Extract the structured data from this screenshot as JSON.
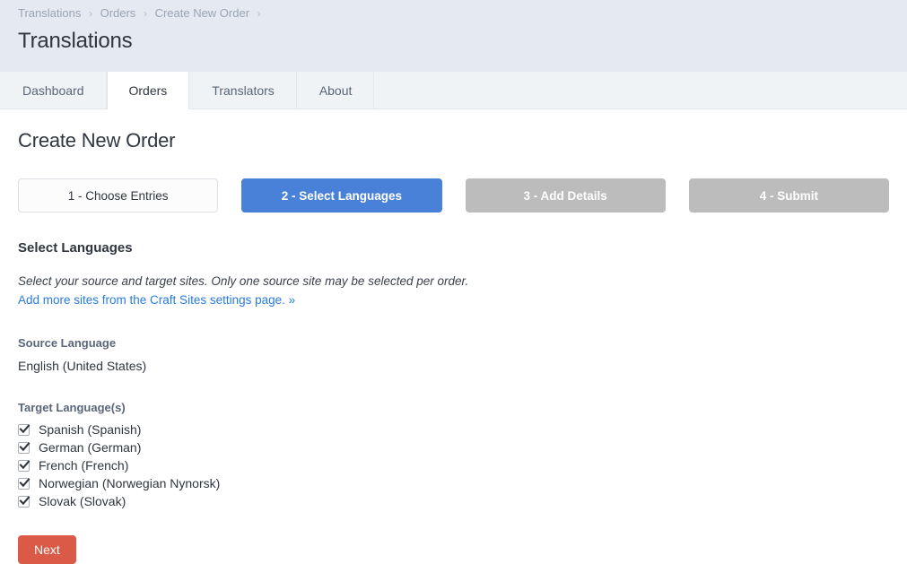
{
  "header": {
    "breadcrumbs": [
      {
        "label": "Translations"
      },
      {
        "label": "Orders"
      },
      {
        "label": "Create New Order"
      }
    ],
    "separator": "›",
    "app_title": "Translations"
  },
  "tabs": [
    {
      "label": "Dashboard",
      "active": false
    },
    {
      "label": "Orders",
      "active": true
    },
    {
      "label": "Translators",
      "active": false
    },
    {
      "label": "About",
      "active": false
    }
  ],
  "main": {
    "page_title": "Create New Order",
    "steps": [
      {
        "label": "1 - Choose Entries",
        "state": "complete"
      },
      {
        "label": "2 - Select Languages",
        "state": "current"
      },
      {
        "label": "3 - Add Details",
        "state": "disabled"
      },
      {
        "label": "4 - Submit",
        "state": "disabled"
      }
    ],
    "section_heading": "Select Languages",
    "section_description": "Select your source and target sites. Only one source site may be selected per order.",
    "section_link": "Add more sites from the Craft Sites settings page. »",
    "source_language_label": "Source Language",
    "source_language_value": "English (United States)",
    "target_language_label": "Target Language(s)",
    "target_languages": [
      {
        "label": "Spanish (Spanish)",
        "checked": true
      },
      {
        "label": "German (German)",
        "checked": true
      },
      {
        "label": "French (French)",
        "checked": true
      },
      {
        "label": "Norwegian (Norwegian Nynorsk)",
        "checked": true
      },
      {
        "label": "Slovak (Slovak)",
        "checked": true
      }
    ],
    "next_button": "Next"
  },
  "colors": {
    "header_bg": "#e4e9f2",
    "tabbar_bg": "#f0f3f6",
    "step_current": "#4a81d8",
    "step_disabled": "#bcbcbc",
    "link": "#2a7bde",
    "next_button": "#da5a47"
  }
}
